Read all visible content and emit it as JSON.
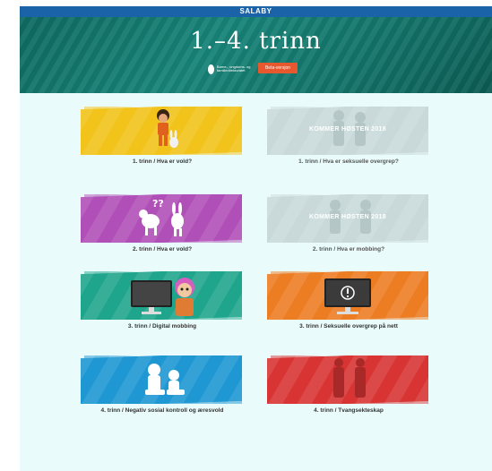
{
  "site": {
    "name": "SALABY"
  },
  "hero": {
    "title": "1.–4. trinn",
    "logo_text": "Barne-, ungdoms- og familiedirektoratet",
    "badge": "Beta-versjon"
  },
  "cards": [
    {
      "caption": "1. trinn / Hva er vold?",
      "color": "#f2c31a",
      "available": true
    },
    {
      "caption": "1. trinn / Hva er seksuelle overgrep?",
      "color": "#c9d9d9",
      "available": false,
      "overlay": "KOMMER HØSTEN 2018"
    },
    {
      "caption": "2. trinn / Hva er vold?",
      "color": "#b04fb8",
      "available": true
    },
    {
      "caption": "2. trinn / Hva er mobbing?",
      "color": "#c9d9d9",
      "available": false,
      "overlay": "KOMMER HØSTEN 2018"
    },
    {
      "caption": "3. trinn / Digital mobbing",
      "color": "#1fa58c",
      "available": true
    },
    {
      "caption": "3. trinn / Seksuelle overgrep på nett",
      "color": "#ec7d23",
      "available": true
    },
    {
      "caption": "4. trinn / Negativ sosial kontroll og æresvold",
      "color": "#1e97d3",
      "available": true
    },
    {
      "caption": "4. trinn / Tvangsekteskap",
      "color": "#d83434",
      "available": true
    }
  ]
}
